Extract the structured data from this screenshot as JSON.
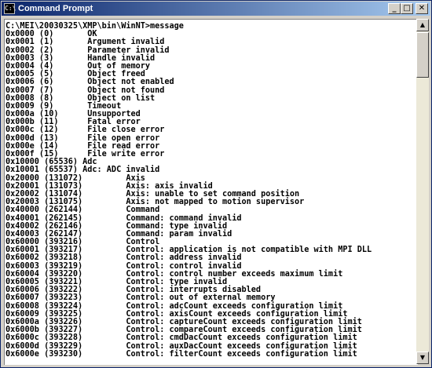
{
  "window": {
    "title": "Command Prompt",
    "icon": "cmd-icon",
    "controls": {
      "minimize": "_",
      "maximize": "□",
      "close": "✕"
    }
  },
  "console": {
    "lines": [
      "C:\\MEI\\20030325\\XMP\\bin\\WinNT>message",
      "0x0000 (0)       OK",
      "0x0001 (1)       Argument invalid",
      "0x0002 (2)       Parameter invalid",
      "0x0003 (3)       Handle invalid",
      "0x0004 (4)       Out of memory",
      "0x0005 (5)       Object freed",
      "0x0006 (6)       Object not enabled",
      "0x0007 (7)       Object not found",
      "0x0008 (8)       Object on list",
      "0x0009 (9)       Timeout",
      "0x000a (10)      Unsupported",
      "0x000b (11)      Fatal error",
      "0x000c (12)      File close error",
      "0x000d (13)      File open error",
      "0x000e (14)      File read error",
      "0x000f (15)      File write error",
      "0x10000 (65536) Adc",
      "0x10001 (65537) Adc: ADC invalid",
      "0x20000 (131072)         Axis",
      "0x20001 (131073)         Axis: axis invalid",
      "0x20002 (131074)         Axis: unable to set command position",
      "0x20003 (131075)         Axis: not mapped to motion supervisor",
      "0x40000 (262144)         Command",
      "0x40001 (262145)         Command: command invalid",
      "0x40002 (262146)         Command: type invalid",
      "0x40003 (262147)         Command: param invalid",
      "0x60000 (393216)         Control",
      "0x60001 (393217)         Control: application is not compatible with MPI DLL",
      "0x60002 (393218)         Control: address invalid",
      "0x60003 (393219)         Control: control invalid",
      "0x60004 (393220)         Control: control number exceeds maximum limit",
      "0x60005 (393221)         Control: type invalid",
      "0x60006 (393222)         Control: interrupts disabled",
      "0x60007 (393223)         Control: out of external memory",
      "0x60008 (393224)         Control: adcCount exceeds configuration limit",
      "0x60009 (393225)         Control: axisCount exceeds configuration limit",
      "0x6000a (393226)         Control: captureCount exceeds configuration limit",
      "0x6000b (393227)         Control: compareCount exceeds configuration limit",
      "0x6000c (393228)         Control: cmdDacCount exceeds configuration limit",
      "0x6000d (393229)         Control: auxDacCount exceeds configuration limit",
      "0x6000e (393230)         Control: filterCount exceeds configuration limit"
    ]
  },
  "scrollbar": {
    "up_arrow": "▲",
    "down_arrow": "▼"
  }
}
